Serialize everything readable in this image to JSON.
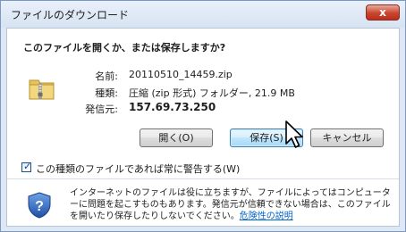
{
  "window": {
    "title": "ファイルのダウンロード",
    "close_label": "x"
  },
  "dialog": {
    "question": "このファイルを開くか、または保存しますか?",
    "name_label": "名前:",
    "name_value": "20110510_14459.zip",
    "type_label": "種類:",
    "type_value": "圧縮 (zip 形式) フォルダー, 21.9 MB",
    "from_label": "発信元:",
    "from_value": "157.69.73.250"
  },
  "buttons": {
    "open": "開く(O)",
    "save": "保存(S)",
    "cancel": "キャンセル"
  },
  "checkbox": {
    "checked": true,
    "label": "この種類のファイルであれば常に警告する(W)"
  },
  "warning": {
    "text": "インターネットのファイルは役に立ちますが、ファイルによってはコンピューターに問題を起こすものもあります。発信元が信頼できない場合は、このファイルを開いたり保存したりしないでください。",
    "link": "危険性の説明"
  },
  "icons": {
    "file": "zip-folder-icon",
    "shield": "shield-question-icon",
    "cursor": "mouse-pointer"
  }
}
